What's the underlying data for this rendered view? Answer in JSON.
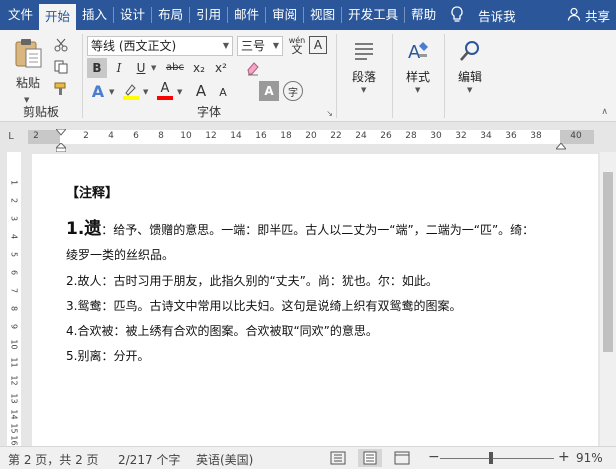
{
  "tabs": [
    {
      "label": "文件",
      "active": false
    },
    {
      "label": "开始",
      "active": true
    },
    {
      "label": "插入",
      "active": false
    },
    {
      "label": "设计",
      "active": false
    },
    {
      "label": "布局",
      "active": false
    },
    {
      "label": "引用",
      "active": false
    },
    {
      "label": "邮件",
      "active": false
    },
    {
      "label": "审阅",
      "active": false
    },
    {
      "label": "视图",
      "active": false
    },
    {
      "label": "开发工具",
      "active": false
    },
    {
      "label": "帮助",
      "active": false
    }
  ],
  "tell_me": "告诉我",
  "share": "共享",
  "ribbon": {
    "clipboard": {
      "paste": "粘贴",
      "label": "剪贴板"
    },
    "font": {
      "font_name": "等线 (西文正文)",
      "font_size": "三号",
      "label": "字体",
      "buttons": [
        "B",
        "I",
        "U",
        "abc",
        "x₂",
        "x²"
      ],
      "wen": "wén",
      "wen_char": "文",
      "a_box": "A",
      "zi": "字"
    },
    "paragraph": {
      "label": "段落"
    },
    "styles": {
      "label": "样式"
    },
    "editing": {
      "label": "编辑"
    }
  },
  "ruler": {
    "corner": "L",
    "ticks": [
      "2",
      "2",
      "4",
      "6",
      "8",
      "10",
      "12",
      "14",
      "16",
      "18",
      "20",
      "22",
      "24",
      "26",
      "28",
      "30",
      "32",
      "34",
      "36",
      "38",
      "40"
    ]
  },
  "vruler": {
    "ticks": [
      "1",
      "2",
      "3",
      "4",
      "5",
      "6",
      "7",
      "8",
      "9",
      "10",
      "11",
      "12",
      "13",
      "14",
      "15",
      "16"
    ]
  },
  "document": {
    "heading": "【注释】",
    "item1_num": "1.",
    "item1_word": "遗",
    "item1_text": "：给予、馈赠的意思。一端：即半匹。古人以二丈为一“端”，二端为一“匹”。绮：",
    "item1_cont": "绫罗一类的丝织品。",
    "item2": "2.故人：古时习用于朋友，此指久别的“丈夫”。尚：犹也。尔：如此。",
    "item3": "3.鸳鸯：匹鸟。古诗文中常用以比夫妇。这句是说绮上织有双鸳鸯的图案。",
    "item4": "4.合欢被：被上绣有合欢的图案。合欢被取“同欢”的意思。",
    "item5": "5.别离：分开。"
  },
  "status": {
    "page": "第 2 页，共 2 页",
    "words": "2/217 个字",
    "lang": "英语(美国)",
    "minus": "−",
    "plus": "+",
    "zoom": "91%",
    "zoom_level": 0.91
  },
  "colors": {
    "brand": "#2b579a",
    "highlight": "#ffff00",
    "font_color": "#ff0000"
  }
}
